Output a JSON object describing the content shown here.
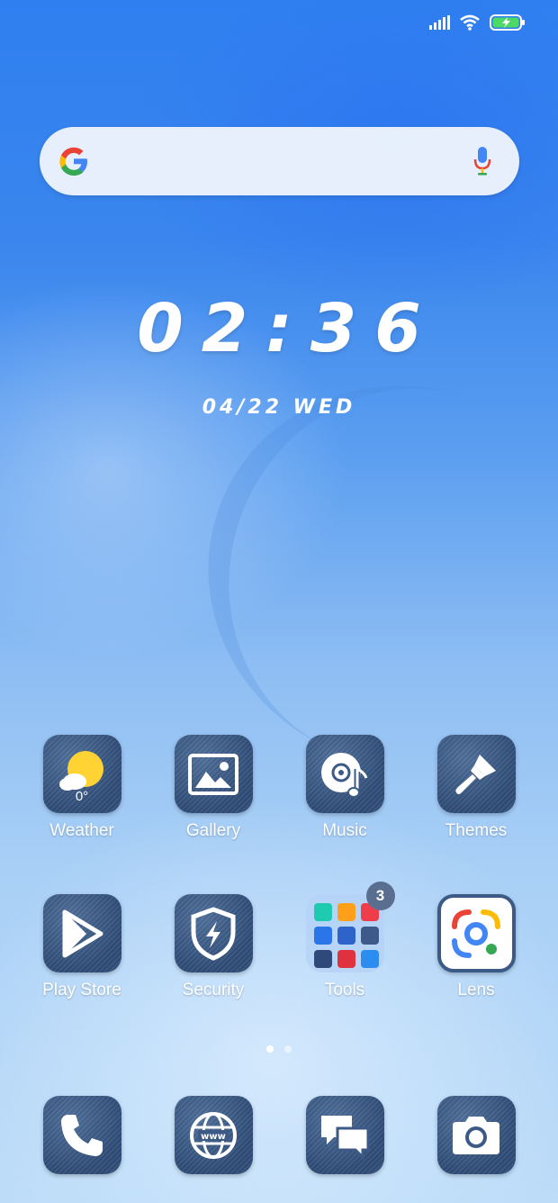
{
  "status_bar": {
    "signal_icon": "signal-icon",
    "wifi_icon": "wifi-icon",
    "battery_icon": "battery-charging-icon"
  },
  "search": {
    "placeholder": "",
    "logo_icon": "google-g-icon",
    "mic_icon": "mic-icon"
  },
  "clock": {
    "time": "02:36",
    "date": "04/22 WED"
  },
  "apps": [
    {
      "label": "Weather",
      "temp": "0°",
      "icon": "weather-icon"
    },
    {
      "label": "Gallery",
      "icon": "gallery-icon"
    },
    {
      "label": "Music",
      "icon": "music-icon"
    },
    {
      "label": "Themes",
      "icon": "themes-icon"
    },
    {
      "label": "Play Store",
      "icon": "play-store-icon"
    },
    {
      "label": "Security",
      "icon": "security-icon"
    },
    {
      "label": "Tools",
      "icon": "folder-icon",
      "badge": "3"
    },
    {
      "label": "Lens",
      "icon": "lens-icon"
    }
  ],
  "dock": [
    {
      "name": "phone",
      "icon": "phone-icon"
    },
    {
      "name": "browser",
      "icon": "browser-icon"
    },
    {
      "name": "messages",
      "icon": "messages-icon"
    },
    {
      "name": "camera",
      "icon": "camera-icon"
    }
  ],
  "pages": {
    "count": 2,
    "active": 1
  },
  "colors": {
    "battery_fill": "#4cd964",
    "tile": "#3b5a86",
    "badge": "#5a6f8f"
  }
}
